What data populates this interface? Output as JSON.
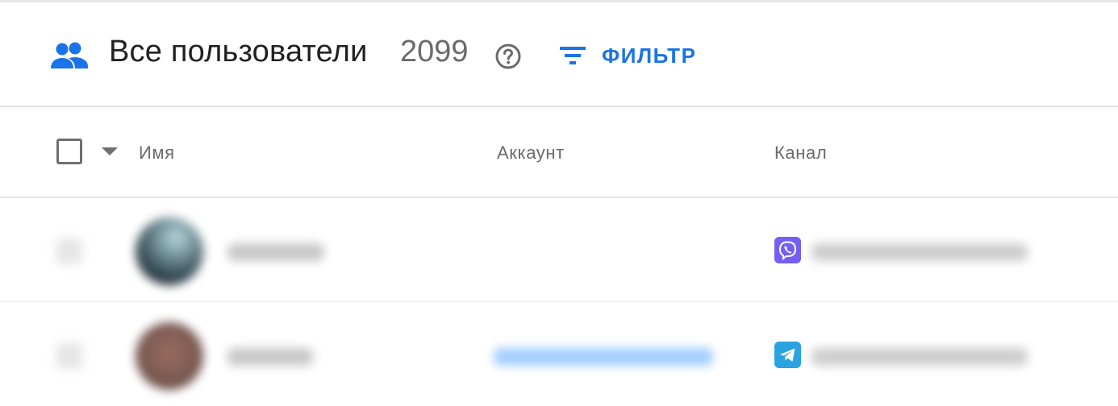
{
  "header": {
    "title": "Все пользователи",
    "count": "2099",
    "filter_label": "ФИЛЬТР",
    "icons": [
      "users-icon",
      "help-icon",
      "filter-icon"
    ],
    "accent_color": "#1a73e8"
  },
  "table": {
    "columns": [
      "Имя",
      "Аккаунт",
      "Канал"
    ],
    "rows": [
      {
        "channel_icon": "viber-icon"
      },
      {
        "channel_icon": "telegram-icon"
      }
    ]
  }
}
